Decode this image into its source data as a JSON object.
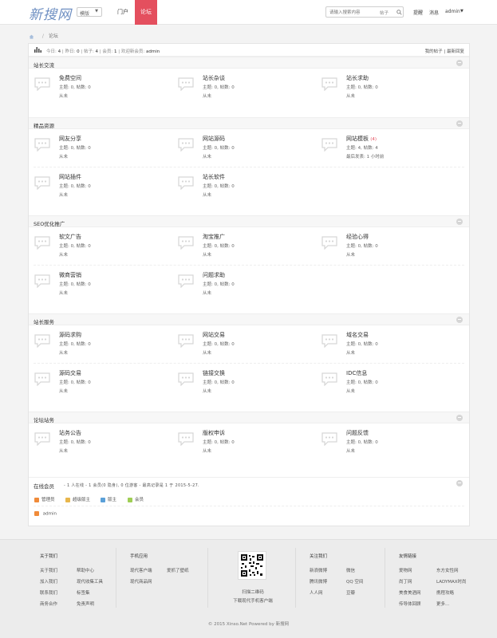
{
  "header": {
    "logo_text": "新搜网",
    "template_select": "模版",
    "nav": {
      "portal": "门户",
      "forum": "论坛"
    },
    "search_placeholder": "请输入搜索内容",
    "search_type": "帖子",
    "links": {
      "remind": "提醒",
      "messages": "消息",
      "user": "admin"
    }
  },
  "breadcrumb": {
    "current": "论坛"
  },
  "stats": {
    "today_label": "今日:",
    "today": "4",
    "yesterday_label": "昨日:",
    "yesterday": "0",
    "posts_label": "帖子:",
    "posts": "4",
    "members_label": "会员:",
    "members": "1",
    "welcome_label": "欢迎新会员:",
    "welcome_user": "admin",
    "my_posts": "我的帖子",
    "latest_replies": "最新回复"
  },
  "categories": [
    {
      "title": "站长交流",
      "forums": [
        {
          "name": "免费空间",
          "new": "",
          "meta": "主题: 0, 帖数: 0",
          "last": "从未"
        },
        {
          "name": "站长杂谈",
          "new": "",
          "meta": "主题: 0, 帖数: 0",
          "last": "从未"
        },
        {
          "name": "站长求助",
          "new": "",
          "meta": "主题: 0, 帖数: 0",
          "last": "从未"
        }
      ]
    },
    {
      "title": "精品资源",
      "forums": [
        {
          "name": "网友分享",
          "new": "",
          "meta": "主题: 0, 帖数: 0",
          "last": "从未"
        },
        {
          "name": "网站源码",
          "new": "",
          "meta": "主题: 0, 帖数: 0",
          "last": "从未"
        },
        {
          "name": "网站模板",
          "new": "(4)",
          "meta": "主题: 4, 帖数: 4",
          "last": "最后发表: 1 小时前"
        },
        {
          "name": "网站插件",
          "new": "",
          "meta": "主题: 0, 帖数: 0",
          "last": "从未"
        },
        {
          "name": "站长软件",
          "new": "",
          "meta": "主题: 0, 帖数: 0",
          "last": "从未"
        }
      ]
    },
    {
      "title": "SEO优化推广",
      "forums": [
        {
          "name": "软文广告",
          "new": "",
          "meta": "主题: 0, 帖数: 0",
          "last": "从未"
        },
        {
          "name": "淘宝推广",
          "new": "",
          "meta": "主题: 0, 帖数: 0",
          "last": "从未"
        },
        {
          "name": "经验心得",
          "new": "",
          "meta": "主题: 0, 帖数: 0",
          "last": "从未"
        },
        {
          "name": "微商营销",
          "new": "",
          "meta": "主题: 0, 帖数: 0",
          "last": "从未"
        },
        {
          "name": "问题求助",
          "new": "",
          "meta": "主题: 0, 帖数: 0",
          "last": "从未"
        }
      ]
    },
    {
      "title": "站长服务",
      "forums": [
        {
          "name": "源码求购",
          "new": "",
          "meta": "主题: 0, 帖数: 0",
          "last": "从未"
        },
        {
          "name": "网站交易",
          "new": "",
          "meta": "主题: 0, 帖数: 0",
          "last": "从未"
        },
        {
          "name": "域名交易",
          "new": "",
          "meta": "主题: 0, 帖数: 0",
          "last": "从未"
        },
        {
          "name": "源码交易",
          "new": "",
          "meta": "主题: 0, 帖数: 0",
          "last": "从未"
        },
        {
          "name": "链接交换",
          "new": "",
          "meta": "主题: 0, 帖数: 0",
          "last": "从未"
        },
        {
          "name": "IDC信息",
          "new": "",
          "meta": "主题: 0, 帖数: 0",
          "last": "从未"
        }
      ]
    },
    {
      "title": "论坛站务",
      "forums": [
        {
          "name": "站务公告",
          "new": "",
          "meta": "主题: 0, 帖数: 0",
          "last": "从未"
        },
        {
          "name": "版权申诉",
          "new": "",
          "meta": "主题: 0, 帖数: 0",
          "last": "从未"
        },
        {
          "name": "问题反馈",
          "new": "",
          "meta": "主题: 0, 帖数: 0",
          "last": "从未"
        }
      ]
    }
  ],
  "online": {
    "title": "在线会员",
    "stats": "- 1 人在线 - 1 会员(0 隐身), 0 位游客 - 最高记录是 1 于 2015-5-27.",
    "legend": [
      "管理员",
      "超级版主",
      "版主",
      "会员"
    ],
    "user": "admin"
  },
  "colors": {
    "legend": [
      "#f08b3a",
      "#e8b64c",
      "#5aa0d8",
      "#9fce55"
    ]
  },
  "footer": {
    "about_title": "关于我们",
    "about_links": [
      "关于我们",
      "帮助中心",
      "加入我们",
      "现代收集工具",
      "联系我们",
      "标签集",
      "商务合作",
      "免责声明"
    ],
    "mobile_title": "手机应用",
    "mobile_links": [
      "现代客户端",
      "爱抓了壁纸",
      "现代商品网"
    ],
    "qr_text1": "扫描二维码",
    "qr_text2": "下载现代手机客户端",
    "follow_title": "关注我们",
    "follow_links": [
      "新浪微博",
      "微信",
      "腾讯微博",
      "QQ 空间",
      "人人网",
      "豆瓣"
    ],
    "friend_title": "友情链接",
    "friend_links": [
      "爱物网",
      "东方女性网",
      "尚丁网",
      "LADYMAX时尚",
      "美食美酒网",
      "携程攻略",
      "传导体回顾",
      "更多..."
    ],
    "copyright": "© 2015 Xinso.Net Powered by 新搜网"
  }
}
